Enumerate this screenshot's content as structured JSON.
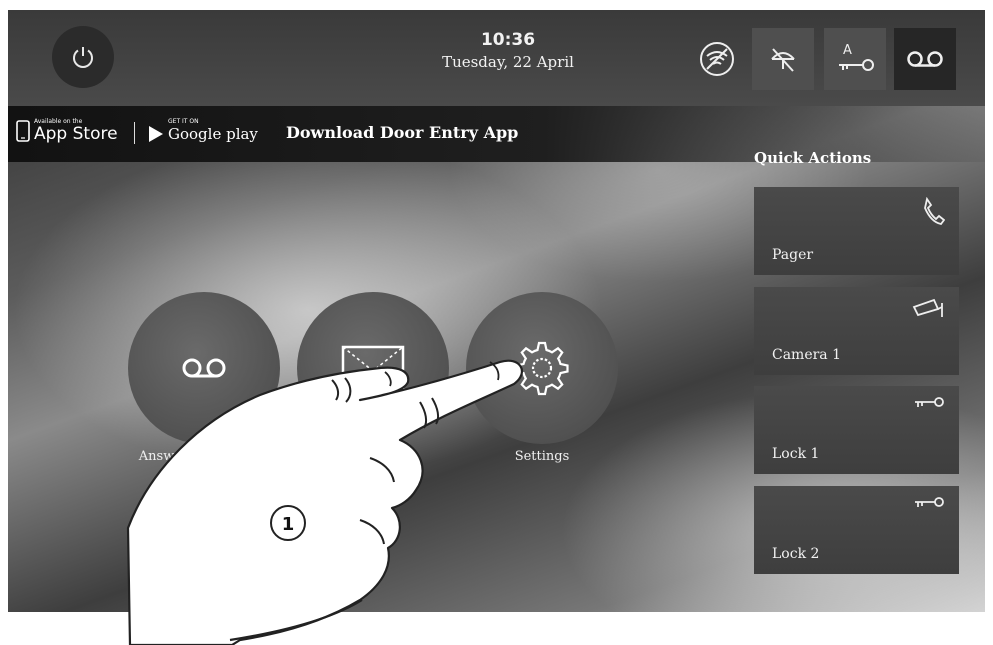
{
  "header": {
    "time": "10:36",
    "date": "Tuesday, 22 April"
  },
  "status_icons": [
    "wifi-off-icon",
    "sensor-off-icon",
    "lock-a-key-icon",
    "voicemail-icon"
  ],
  "banner": {
    "appstore_small": "Available on the",
    "appstore_big": "App Store",
    "googleplay_small": "GET IT ON",
    "googleplay_big": "Google play",
    "title": "Download Door Entry App"
  },
  "main": {
    "buttons": [
      {
        "label": "Answering machine",
        "icon": "voicemail-icon"
      },
      {
        "label": "",
        "icon": "envelope-icon"
      },
      {
        "label": "Settings",
        "icon": "gear-icon"
      }
    ]
  },
  "quick_actions": {
    "title": "Quick Actions",
    "items": [
      {
        "label": "Pager",
        "icon": "phone-icon"
      },
      {
        "label": "Camera 1",
        "icon": "camera-icon"
      },
      {
        "label": "Lock 1",
        "icon": "key-icon"
      },
      {
        "label": "Lock 2",
        "icon": "key-icon"
      }
    ]
  },
  "annotation": {
    "step_number": "1"
  },
  "colors": {
    "tile": "#454545",
    "banner": "#141414",
    "text": "#f2f2f2"
  }
}
